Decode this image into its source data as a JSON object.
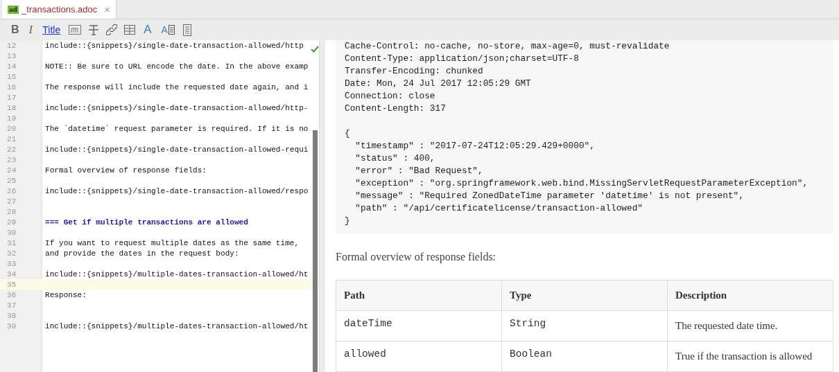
{
  "tab": {
    "badge": "ad",
    "label": "_transactions.adoc",
    "close": "×",
    "selected": true
  },
  "toolbar": [
    {
      "kind": "bold",
      "label": "B"
    },
    {
      "kind": "italic",
      "label": "I"
    },
    {
      "kind": "title",
      "label": "Title"
    },
    {
      "kind": "mono"
    },
    {
      "kind": "strike"
    },
    {
      "kind": "link"
    },
    {
      "kind": "table"
    },
    {
      "kind": "letter",
      "label": "A"
    },
    {
      "kind": "letter-box",
      "label": "A"
    },
    {
      "kind": "doc"
    }
  ],
  "editor": {
    "lines": [
      {
        "number": "12",
        "text": "include::{snippets}/single-date-transaction-allowed/http",
        "kind": "plain",
        "current": false
      },
      {
        "number": "13",
        "current": false
      },
      {
        "number": "14",
        "text": "NOTE:: Be sure to URL encode the date. In the above examp",
        "kind": "plain",
        "current": false
      },
      {
        "number": "15",
        "current": false
      },
      {
        "number": "16",
        "text": "The response will include the requested date again, and i",
        "kind": "plain",
        "current": false
      },
      {
        "number": "17",
        "current": false
      },
      {
        "number": "18",
        "text": "include::{snippets}/single-date-transaction-allowed/http-",
        "kind": "plain",
        "current": false
      },
      {
        "number": "19",
        "current": false
      },
      {
        "number": "20",
        "text": "The `datetime` request parameter is required. If it is no",
        "kind": "plain",
        "current": false
      },
      {
        "number": "21",
        "current": false
      },
      {
        "number": "22",
        "text": "include::{snippets}/single-date-transaction-allowed-requi",
        "kind": "plain",
        "current": false
      },
      {
        "number": "23",
        "current": false
      },
      {
        "number": "24",
        "text": "Formal overview of response fields:",
        "kind": "plain",
        "current": false
      },
      {
        "number": "25",
        "current": false
      },
      {
        "number": "26",
        "text": "include::{snippets}/single-date-transaction-allowed/respo",
        "kind": "plain",
        "current": false
      },
      {
        "number": "27",
        "current": false
      },
      {
        "number": "28",
        "current": false
      },
      {
        "number": "29",
        "text": "=== Get if multiple transactions are allowed",
        "kind": "heading",
        "current": false
      },
      {
        "number": "30",
        "current": false
      },
      {
        "number": "31",
        "text": "If you want to request multiple dates as the same time,",
        "kind": "plain",
        "current": false
      },
      {
        "number": "32",
        "text": "and provide the dates in the request body:",
        "kind": "plain",
        "current": false
      },
      {
        "number": "33",
        "current": false
      },
      {
        "number": "34",
        "text": "include::{snippets}/multiple-dates-transaction-allowed/ht",
        "kind": "plain",
        "current": false
      },
      {
        "number": "35",
        "current": true
      },
      {
        "number": "36",
        "text": "Response:",
        "kind": "plain",
        "current": false
      },
      {
        "number": "37",
        "current": false
      },
      {
        "number": "38",
        "current": false
      },
      {
        "number": "39",
        "text": "include::{snippets}/multiple-dates-transaction-allowed/ht",
        "kind": "plain",
        "current": false
      }
    ]
  },
  "preview": {
    "header_lines": [
      "Cache-Control: no-cache, no-store, max-age=0, must-revalidate",
      "Content-Type: application/json;charset=UTF-8",
      "Transfer-Encoding: chunked",
      "Date: Mon, 24 Jul 2017 12:05:29 GMT",
      "Connection: close",
      "Content-Length: 317"
    ],
    "body_lines": [
      "{",
      "  \"timestamp\" : \"2017-07-24T12:05:29.429+0000\",",
      "  \"status\" : 400,",
      "  \"error\" : \"Bad Request\",",
      "  \"exception\" : \"org.springframework.web.bind.MissingServletRequestParameterException\",",
      "  \"message\" : \"Required ZonedDateTime parameter 'datetime' is not present\",",
      "  \"path\" : \"/api/certificatelicense/transaction-allowed\"",
      "}"
    ],
    "paragraph": "Formal overview of response fields:",
    "table": {
      "columns": [
        "Path",
        "Type",
        "Description"
      ],
      "rows": [
        [
          "dateTime",
          "String",
          "The requested date time."
        ],
        [
          "allowed",
          "Boolean",
          "True if the transaction is allowed"
        ]
      ]
    }
  }
}
